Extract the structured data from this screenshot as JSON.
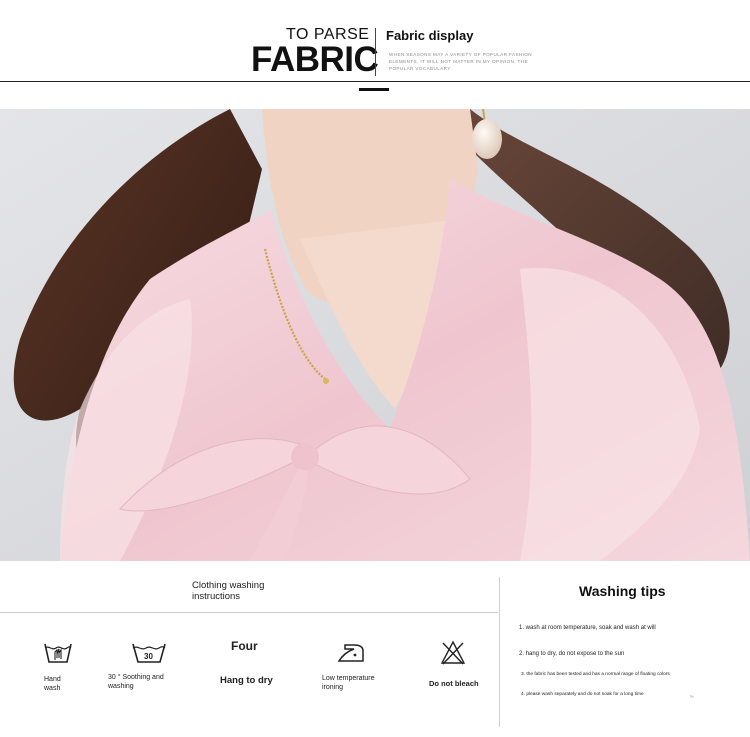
{
  "header": {
    "to_parse": "TO PARSE",
    "fabric": "FABRIC",
    "fabric_display": "Fabric display",
    "tagline": "WHEN SEASONS MAY A VARIETY OF POPULAR FASHION ELEMENTS, IT WILL NOT MATTER IN MY OPINION, THE POPULAR VOCABULARY"
  },
  "photo": {
    "subject": "woman wearing pink satin blouse with bow tie, gold chain and pearl earring",
    "colors": {
      "blouse": "#f2cfd6",
      "skin": "#f1d3c3",
      "hair": "#4a2a1f",
      "background": "#dcdde0"
    }
  },
  "care": {
    "title": "Clothing washing instructions",
    "symbols": [
      {
        "icon": "hand-wash-icon",
        "label": "Hand wash"
      },
      {
        "icon": "wash-30-icon",
        "icon_text": "30",
        "label": "30 ° Soothing and washing"
      },
      {
        "icon": "four-text",
        "icon_text": "Four",
        "label": "Hang to dry"
      },
      {
        "icon": "iron-low-icon",
        "label": "Low temperature ironing"
      },
      {
        "icon": "do-not-bleach-icon",
        "label": "Do not bleach"
      }
    ],
    "tips_title": "Washing tips",
    "tips": [
      "1. wash at room temperature, soak and wash at will",
      "2. hang to dry, do not expose to the sun",
      "3. the fabric has been tested and has a normal range of floating colors",
      "4. please wash separately and do not soak for a long time"
    ],
    "tips_mark": "™"
  }
}
